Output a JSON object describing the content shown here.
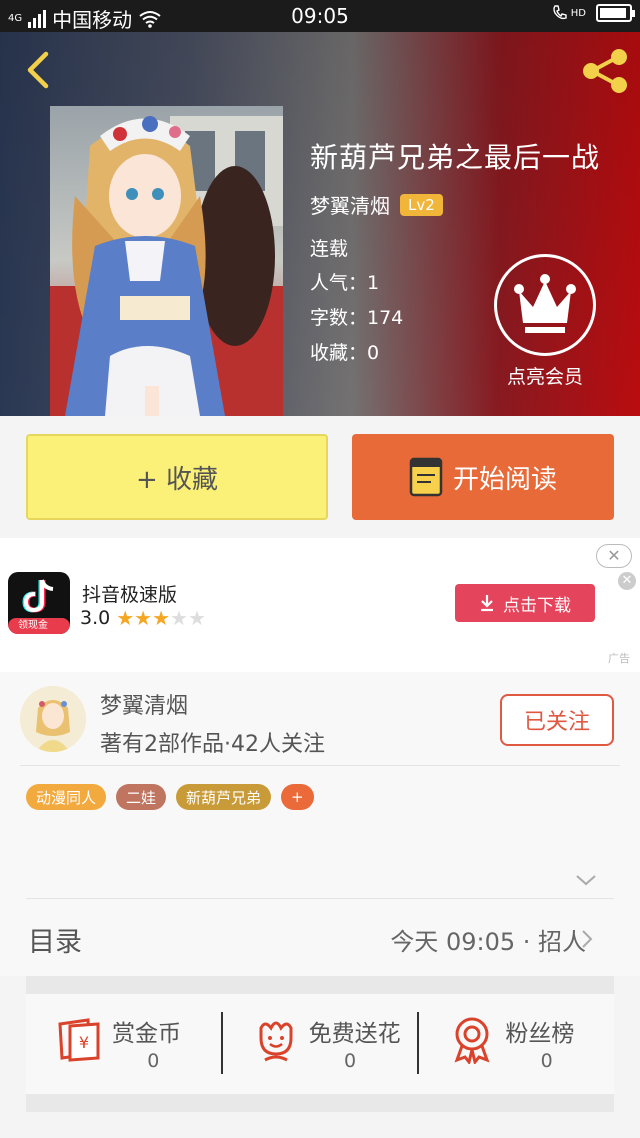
{
  "status_bar": {
    "network": "4G",
    "carrier": "中国移动",
    "time": "09:05",
    "hd": "HD"
  },
  "book": {
    "title": "新葫芦兄弟之最后一战",
    "author": "梦翼清烟",
    "level": "Lv2",
    "status": "连载",
    "popularity": "人气：1",
    "word_count": "字数：174",
    "favorites": "收藏：0"
  },
  "vip": {
    "label": "点亮会员"
  },
  "actions": {
    "favorite_label": "+ 收藏",
    "read_label": "开始阅读"
  },
  "ad": {
    "app_name": "抖音极速版",
    "rating": "3.0",
    "stars_filled": 3,
    "stars_total": 5,
    "icon_badge": "领现金",
    "download_label": "点击下载",
    "ad_label": "广告",
    "close_symbol": "✕"
  },
  "author_section": {
    "name": "梦翼清烟",
    "stats": "著有2部作品·42人关注",
    "follow_label": "已关注",
    "tags": [
      {
        "label": "动漫同人",
        "color": "#f2aa3e"
      },
      {
        "label": "二娃",
        "color": "#c07560"
      },
      {
        "label": "新葫芦兄弟",
        "color": "#c99b38"
      },
      {
        "label": "+",
        "color": "#ea6a3a"
      }
    ]
  },
  "catalog": {
    "label": "目录",
    "updated": "今天 09:05 · 招人"
  },
  "rewards": [
    {
      "label": "赏金币",
      "value": "0",
      "icon": "red-envelope-icon"
    },
    {
      "label": "免费送花",
      "value": "0",
      "icon": "flower-icon"
    },
    {
      "label": "粉丝榜",
      "value": "0",
      "icon": "medal-icon"
    }
  ],
  "colors": {
    "accent_orange": "#e86a38",
    "favorite_yellow": "#fbf078",
    "follow_red": "#e05840",
    "reward_red": "#d9432b"
  }
}
